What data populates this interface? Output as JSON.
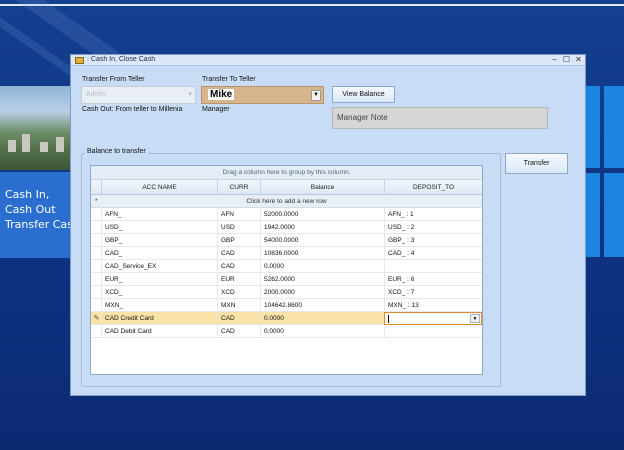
{
  "desktop": {
    "side_text": [
      "Cash In,",
      "Cash Out",
      "Transfer Cash"
    ]
  },
  "window": {
    "title": ": Cash In, Close Cash",
    "controls": {
      "minimize": "–",
      "maximize": "☐",
      "close": "✕"
    }
  },
  "form": {
    "from_teller_label": "Transfer From Teller",
    "from_teller_value": "Admin",
    "to_teller_label": "Transfer To Teller",
    "to_teller_value": "Mike",
    "view_balance_label": "View Balance",
    "cash_out_text": "Cash Out: From teller  to Millenia",
    "role_label": "Manager",
    "manager_note_placeholder": "Manager Note",
    "group_title": "Balance to transfer",
    "transfer_label": "Transfer"
  },
  "grid": {
    "group_panel_text": "Drag a column here to group by this column.",
    "columns": [
      "ACC NAME",
      "CURR",
      "Balance",
      "DEPOSIT_TO"
    ],
    "new_row_text": "Click here to add a new row",
    "rows": [
      {
        "acc": "AFN_",
        "curr": "AFN",
        "balance": "52000.0000",
        "deposit": "AFN_ : 1"
      },
      {
        "acc": "USD_",
        "curr": "USD",
        "balance": "1942.0000",
        "deposit": "USD_ : 2"
      },
      {
        "acc": "GBP_",
        "curr": "GBP",
        "balance": "54000.0000",
        "deposit": "GBP_ : 3"
      },
      {
        "acc": "CAD_",
        "curr": "CAD",
        "balance": "10836.0000",
        "deposit": "CAD_ : 4"
      },
      {
        "acc": "CAD_Service_EX",
        "curr": "CAD",
        "balance": "0.0000",
        "deposit": ""
      },
      {
        "acc": "EUR_",
        "curr": "EUR",
        "balance": "5262.0000",
        "deposit": "EUR_ : 6"
      },
      {
        "acc": "XCD_",
        "curr": "XCD",
        "balance": "2000.0000",
        "deposit": "XCD_ : 7"
      },
      {
        "acc": "MXN_",
        "curr": "MXN",
        "balance": "104642.8600",
        "deposit": "MXN_ : 13"
      },
      {
        "acc": "CAD Credit Card",
        "curr": "CAD",
        "balance": "0.0000",
        "deposit": ""
      },
      {
        "acc": "CAD Debit Card",
        "curr": "CAD",
        "balance": "0.0000",
        "deposit": ""
      }
    ],
    "active_row_index": 8,
    "active_row_indicator": "✎"
  },
  "colors": {
    "dialog_bg": "#c9dcf5",
    "active_row": "#fbe3a8",
    "combo_mike": "#d6b58d",
    "editor_border": "#e08a30",
    "desktop_bg": "#0f3585"
  }
}
